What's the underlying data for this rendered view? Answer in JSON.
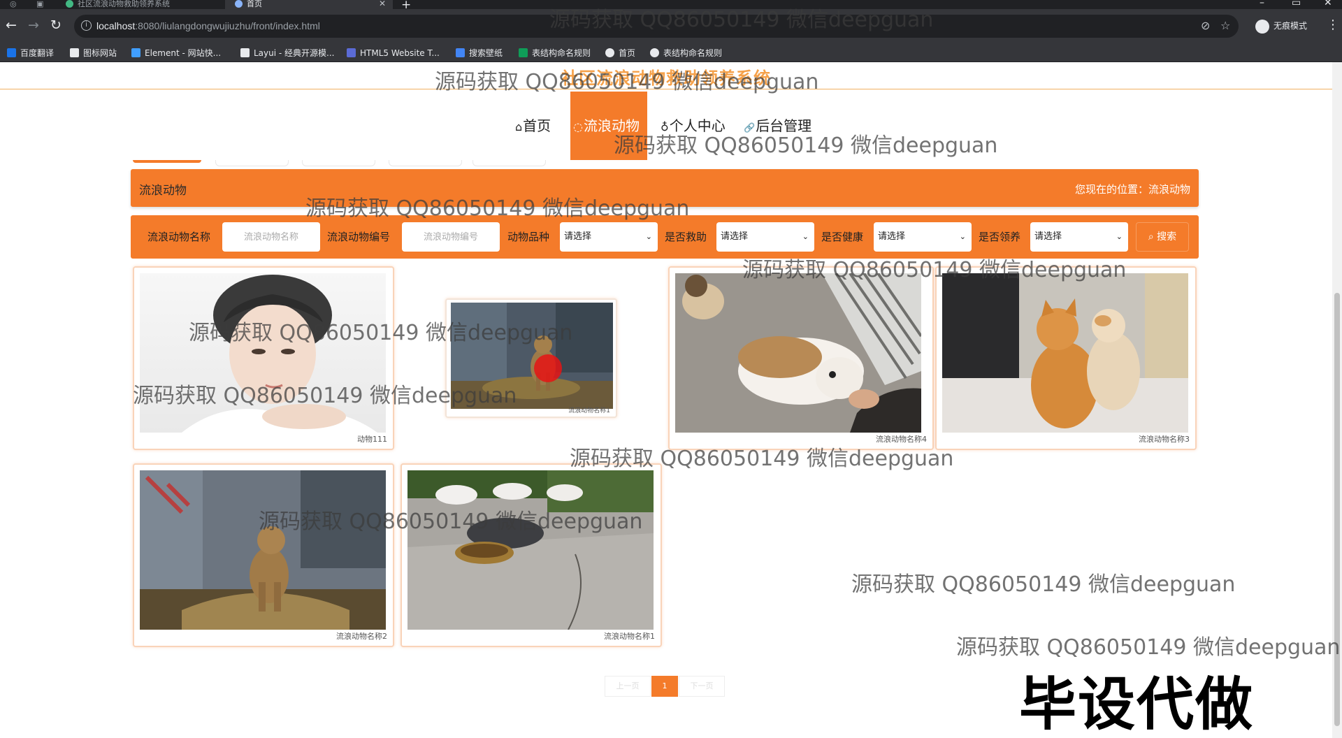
{
  "browser": {
    "tabs": [
      {
        "title": "社区流浪动物救助领养系统"
      },
      {
        "title": "首页"
      }
    ],
    "url_host": "localhost",
    "url_rest": ":8080/liulangdongwujiuzhu/front/index.html",
    "incognito_label": "无痕模式",
    "bookmarks": [
      {
        "label": "百度翻译",
        "color": "#1a73e8"
      },
      {
        "label": "图标网站",
        "color": "#e8eaed"
      },
      {
        "label": "Element - 网站快...",
        "color": "#409eff"
      },
      {
        "label": "Layui - 经典开源模...",
        "color": "#e8eaed"
      },
      {
        "label": "HTML5 Website T...",
        "color": "#5b6bd6"
      },
      {
        "label": "搜索壁纸",
        "color": "#4285f4"
      },
      {
        "label": "表结构命名规则",
        "color": "#0f9d58"
      },
      {
        "label": "首页",
        "color": "#e8eaed"
      },
      {
        "label": "表结构命名规则",
        "color": "#e8eaed"
      }
    ]
  },
  "site": {
    "title": "社区流浪动物救助领养系统",
    "nav": [
      {
        "label": "首页",
        "icon": "⌂"
      },
      {
        "label": "流浪动物",
        "icon": "◌"
      },
      {
        "label": "个人中心",
        "icon": "♁"
      },
      {
        "label": "后台管理",
        "icon": "🔗"
      }
    ],
    "breadcrumb": {
      "title": "流浪动物",
      "position": "您现在的位置：流浪动物"
    },
    "search": {
      "name_label": "流浪动物名称",
      "name_placeholder": "流浪动物名称",
      "code_label": "流浪动物编号",
      "code_placeholder": "流浪动物编号",
      "breed_label": "动物品种",
      "rescue_label": "是否救助",
      "health_label": "是否健康",
      "adopt_label": "是否领养",
      "select_default": "请选择",
      "button": "搜索"
    },
    "cards": [
      {
        "caption": "动物111",
        "image": "person-photo"
      },
      {
        "caption": "流浪动物名称1",
        "image": "dog-photo"
      },
      {
        "caption": "流浪动物名称4",
        "image": "puppy-photo"
      },
      {
        "caption": "流浪动物名称3",
        "image": "cats-photo"
      },
      {
        "caption": "流浪动物名称2",
        "image": "dog-photo"
      },
      {
        "caption": "流浪动物名称1",
        "image": "cats-eating-photo"
      }
    ],
    "pager": {
      "prev": "上一页",
      "current": "1",
      "next": "下一页"
    }
  },
  "overlay": {
    "watermark_text": "源码获取 QQ86050149 微信deepguan",
    "stamp_text": "毕设代做"
  }
}
